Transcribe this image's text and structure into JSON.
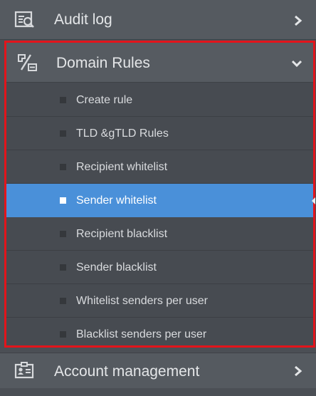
{
  "sidebar": {
    "audit_log": {
      "label": "Audit log",
      "icon": "audit-log-icon"
    },
    "domain_rules": {
      "label": "Domain Rules",
      "icon": "domain-rules-icon",
      "expanded": true,
      "items": [
        {
          "label": "Create rule",
          "active": false
        },
        {
          "label": "TLD &gTLD Rules",
          "active": false
        },
        {
          "label": "Recipient whitelist",
          "active": false
        },
        {
          "label": "Sender whitelist",
          "active": true
        },
        {
          "label": "Recipient blacklist",
          "active": false
        },
        {
          "label": "Sender blacklist",
          "active": false
        },
        {
          "label": "Whitelist senders per user",
          "active": false
        },
        {
          "label": "Blacklist senders per user",
          "active": false
        }
      ]
    },
    "account_management": {
      "label": "Account management",
      "icon": "account-management-icon"
    }
  },
  "colors": {
    "sidebar_bg": "#4b4f55",
    "active_item_bg": "#4a90d9",
    "highlight_border": "#e3141b"
  }
}
